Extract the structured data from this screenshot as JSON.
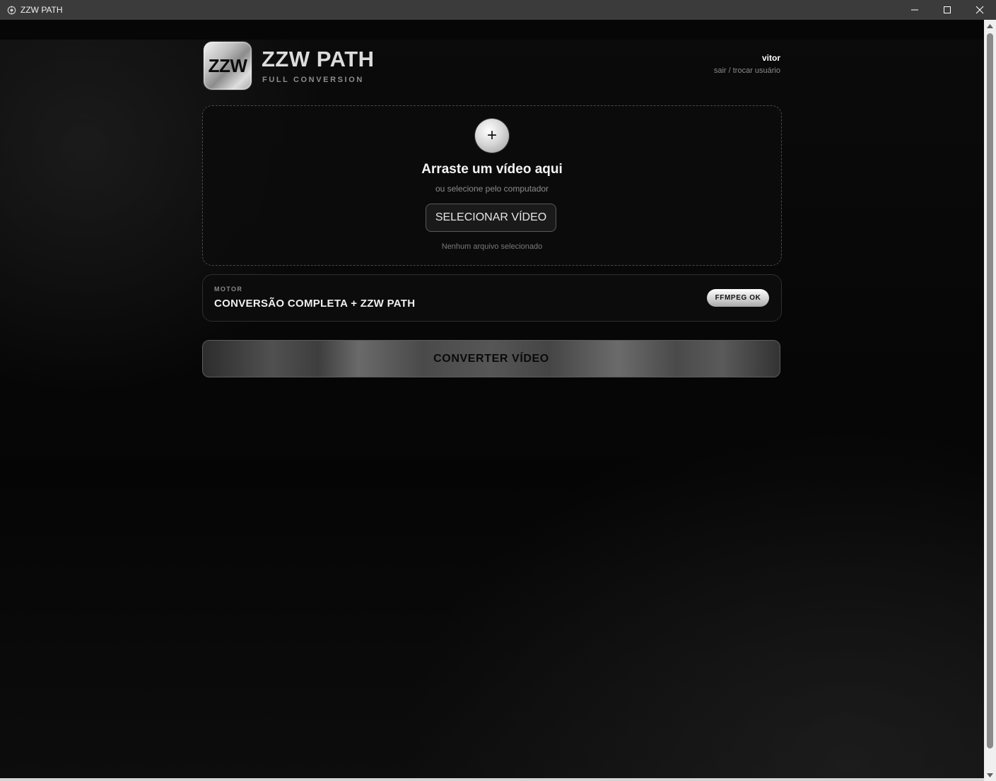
{
  "window": {
    "title": "ZZW PATH"
  },
  "header": {
    "logo_text": "ZZW",
    "title": "ZZW PATH",
    "subtitle": "FULL CONVERSION",
    "user_name": "vitor",
    "user_switch_link": "sair / trocar usuário"
  },
  "dropzone": {
    "plus_symbol": "+",
    "title": "Arraste um vídeo aqui",
    "subtitle": "ou selecione pelo computador",
    "select_button": "SELECIONAR VÍDEO",
    "file_status": "Nenhum arquivo selecionado"
  },
  "motor": {
    "label": "MOTOR",
    "value": "CONVERSÃO COMPLETA + ZZW PATH",
    "badge": "FFMPEG OK"
  },
  "actions": {
    "convert_button": "CONVERTER VÍDEO"
  },
  "icons": {
    "app": "app-icon",
    "minimize": "minimize-icon",
    "maximize": "maximize-icon",
    "close": "close-icon",
    "plus": "plus-icon"
  },
  "colors": {
    "background": "#050505",
    "titlebar": "#3b3b3b",
    "text_primary": "#f0f0f0",
    "text_muted": "#8a8a8a",
    "badge_bg": "#d8d8d8"
  }
}
